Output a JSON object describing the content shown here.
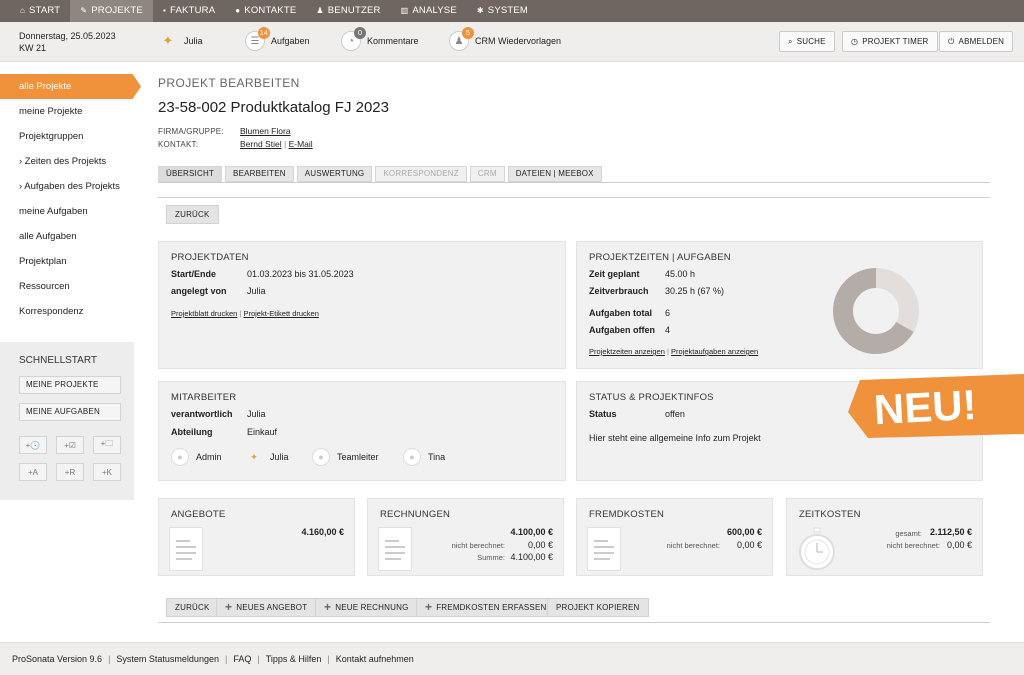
{
  "nav": [
    {
      "label": "START",
      "icon": "home-icon"
    },
    {
      "label": "PROJEKTE",
      "icon": "pen-icon",
      "active": true
    },
    {
      "label": "FAKTURA",
      "icon": "money-icon"
    },
    {
      "label": "KONTAKTE",
      "icon": "contacts-icon"
    },
    {
      "label": "BENUTZER",
      "icon": "users-icon"
    },
    {
      "label": "ANALYSE",
      "icon": "chart-icon"
    },
    {
      "label": "SYSTEM",
      "icon": "gear-icon"
    }
  ],
  "info": {
    "date": "Donnerstag, 25.05.2023",
    "week": "KW 21",
    "user": "Julia",
    "tasks_label": "Aufgaben",
    "tasks_count": "14",
    "comments_label": "Kommentare",
    "comments_count": "0",
    "crm_label": "CRM Wiedervorlagen",
    "crm_count": "5",
    "search": "SUCHE",
    "timer": "PROJEKT TIMER",
    "logout": "ABMELDEN"
  },
  "sidebar": {
    "items": [
      "alle Projekte",
      "meine Projekte",
      "Projektgruppen",
      "› Zeiten des Projekts",
      "› Aufgaben des Projekts",
      "meine Aufgaben",
      "alle Aufgaben",
      "Projektplan",
      "Ressourcen",
      "Korrespondenz"
    ],
    "schnellstart": {
      "title": "SCHNELLSTART",
      "btn1": "MEINE PROJEKTE",
      "btn2": "MEINE AUFGABEN",
      "icons": [
        "+🕓",
        "+☑",
        "+🗀",
        "+A",
        "+R",
        "+K"
      ]
    }
  },
  "main": {
    "heading": "PROJEKT BEARBEITEN",
    "title": "23-58-002 Produktkatalog FJ 2023",
    "firma_label": "FIRMA/GRUPPE:",
    "firma": "Blumen Flora",
    "kontakt_label": "KONTAKT:",
    "kontakt": "Bernd Stiel",
    "kontakt_sep": "|",
    "email": "E-Mail",
    "tabs": [
      {
        "label": "ÜBERSICHT",
        "state": "active"
      },
      {
        "label": "BEARBEITEN",
        "state": "normal"
      },
      {
        "label": "AUSWERTUNG",
        "state": "normal"
      },
      {
        "label": "KORRESPONDENZ",
        "state": "disabled"
      },
      {
        "label": "CRM",
        "state": "disabled"
      },
      {
        "label": "DATEIEN | MEEBOX",
        "state": "normal"
      }
    ],
    "back": "ZURÜCK"
  },
  "projektdaten": {
    "title": "PROJEKTDATEN",
    "start_label": "Start/Ende",
    "start": "01.03.2023 bis 31.05.2023",
    "by_label": "angelegt von",
    "by": "Julia",
    "link1": "Projektblatt drucken",
    "sep": "|",
    "link2": "Projekt-Etikett drucken"
  },
  "zeiten": {
    "title": "PROJEKTZEITEN | AUFGABEN",
    "plan_label": "Zeit geplant",
    "plan": "45.00 h",
    "used_label": "Zeitverbrauch",
    "used": "30.25 h (67 %)",
    "total_label": "Aufgaben total",
    "total": "6",
    "open_label": "Aufgaben offen",
    "open": "4",
    "link1": "Projektzeiten anzeigen",
    "sep": "|",
    "link2": "Projektaufgaben anzeigen",
    "donut_fraction": 0.67,
    "colors": {
      "used": "#b4aca7",
      "rest": "#e1dedc"
    }
  },
  "mitarbeiter": {
    "title": "MITARBEITER",
    "resp_label": "verantwortlich",
    "resp": "Julia",
    "dept_label": "Abteilung",
    "dept": "Einkauf",
    "people": [
      "Admin",
      "Julia",
      "Teamleiter",
      "Tina"
    ]
  },
  "status": {
    "title": "STATUS & PROJEKTINFOS",
    "status_label": "Status",
    "status": "offen",
    "info": "Hier steht eine allgemeine Info zum Projekt"
  },
  "angebote": {
    "title": "ANGEBOTE",
    "amount": "4.160,00 €"
  },
  "rechnungen": {
    "title": "RECHNUNGEN",
    "amount": "4.100,00 €",
    "nb_label": "nicht berechnet:",
    "nb": "0,00 €",
    "sum_label": "Summe:",
    "sum": "4.100,00 €"
  },
  "fremdkosten": {
    "title": "FREMDKOSTEN",
    "amount": "600,00 €",
    "nb_label": "nicht berechnet:",
    "nb": "0,00 €"
  },
  "zeitkosten": {
    "title": "ZEITKOSTEN",
    "ges_label": "gesamt:",
    "ges": "2.112,50 €",
    "nb_label": "nicht berechnet:",
    "nb": "0,00 €"
  },
  "actions": {
    "back": "ZURÜCK",
    "angebot": "NEUES ANGEBOT",
    "rechnung": "NEUE RECHNUNG",
    "fremd": "FREMDKOSTEN ERFASSEN",
    "kopieren": "PROJEKT KOPIEREN"
  },
  "banner": {
    "text": "NEU!",
    "color": "#f0923c"
  },
  "footer": {
    "version": "ProSonata Version 9.6",
    "status": "System Statusmeldungen",
    "faq": "FAQ",
    "tips": "Tipps & Hilfen",
    "contact": "Kontakt aufnehmen",
    "sep": "|"
  }
}
